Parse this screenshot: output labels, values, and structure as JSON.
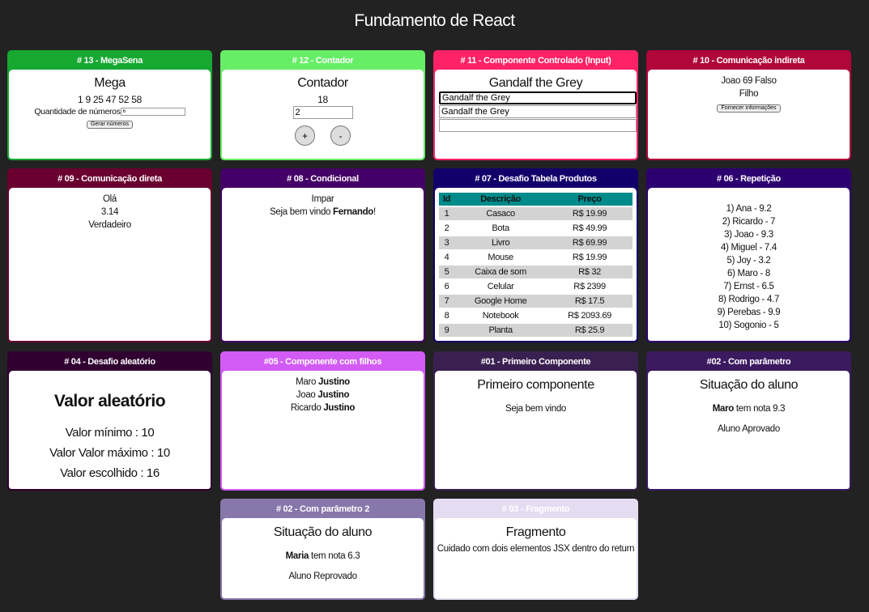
{
  "page": {
    "title": "Fundamento de React"
  },
  "megasena": {
    "header": "# 13 - MegaSena",
    "title": "Mega",
    "numbers": "1 9 25 47 52 58",
    "qty_label": "Quantidade de números",
    "qty_value": "6",
    "button": "Gerar números"
  },
  "contador": {
    "header": "# 12 - Contador",
    "title": "Contador",
    "value": "18",
    "step": "2",
    "plus": "+",
    "minus": "-"
  },
  "controlado": {
    "header": "# 11 - Componente Controlado (Input)",
    "title": "Gandalf the Grey",
    "input1": "Gandalf the Grey",
    "input2": "Gandalf the Grey",
    "input3": ""
  },
  "indireta": {
    "header": "# 10 - Comunicação indireta",
    "line1": "Joao 69 Falso",
    "line2": "Filho",
    "button": "Fornecer informações"
  },
  "direta": {
    "header": "# 09 - Comunicação direta",
    "lines": [
      "Olá",
      "3.14",
      "Verdadeiro"
    ]
  },
  "condicional": {
    "header": "# 08 - Condicional",
    "line1": "Impar",
    "greeting_prefix": "Seja bem vindo ",
    "greeting_name": "Fernando",
    "greeting_suffix": "!"
  },
  "tabela": {
    "header": "# 07 - Desafio Tabela Produtos",
    "columns": [
      "Id",
      "Descrição",
      "Preço"
    ],
    "rows": [
      [
        "1",
        "Casaco",
        "R$ 19.99"
      ],
      [
        "2",
        "Bota",
        "R$ 49.99"
      ],
      [
        "3",
        "Livro",
        "R$ 69.99"
      ],
      [
        "4",
        "Mouse",
        "R$ 19.99"
      ],
      [
        "5",
        "Caixa de som",
        "R$ 32"
      ],
      [
        "6",
        "Celular",
        "R$ 2399"
      ],
      [
        "7",
        "Google Home",
        "R$ 17.5"
      ],
      [
        "8",
        "Notebook",
        "R$ 2093.69"
      ],
      [
        "9",
        "Planta",
        "R$ 25.9"
      ]
    ]
  },
  "repeticao": {
    "header": "# 06 - Repetição",
    "items": [
      "1) Ana - 9.2",
      "2) Ricardo - 7",
      "3) Joao - 9.3",
      "4) Miguel - 7.4",
      "5) Joy - 3.2",
      "6) Maro - 8",
      "7) Ernst - 6.5",
      "8) Rodrigo - 4.7",
      "9) Perebas - 9.9",
      "10) Sogonio - 5"
    ]
  },
  "aleatorio": {
    "header": "# 04 - Desafio aleatório",
    "title": "Valor aleatório",
    "min": "Valor mínimo : 10",
    "max": "Valor Valor máximo : 10",
    "chosen": "Valor escolhido : 16"
  },
  "filhos": {
    "header": "#05 - Componente com filhos",
    "rows": [
      {
        "first": "Maro ",
        "last": "Justino"
      },
      {
        "first": "Joao ",
        "last": "Justino"
      },
      {
        "first": "Ricardo ",
        "last": "Justino"
      }
    ]
  },
  "primeiro": {
    "header": "#01 - Primeiro Componente",
    "title": "Primeiro componente",
    "text": "Seja bem vindo"
  },
  "parametro": {
    "header": "#02 - Com parâmetro",
    "title": "Situação do aluno",
    "name": "Maro",
    "grade_text": " tem nota 9.3",
    "result": "Aluno Aprovado"
  },
  "parametro2": {
    "header": "# 02 - Com parâmetro 2",
    "title": "Situação do aluno",
    "name": "Maria",
    "grade_text": " tem nota 6.3",
    "result": "Aluno Reprovado"
  },
  "fragmento": {
    "header": "# 03 - Fragmento",
    "title": "Fragmento",
    "text": "Cuidado com dois elementos JSX dentro do return"
  },
  "colors": {
    "background": "#222222",
    "megasena": "#17a832",
    "contador": "#66ee66",
    "controlado": "#ff2266",
    "indireta": "#b0063a",
    "direta": "#6a0030",
    "condicional": "#440066",
    "tabela": "#12006a",
    "repeticao": "#2d0070",
    "aleatorio": "#300030",
    "filhos": "#d35bf5",
    "primeiro": "#3a2050",
    "parametro": "#3b1a60",
    "parametro2": "#8877aa",
    "fragmento": "#e4ddf2",
    "table_header": "#008b8b"
  }
}
